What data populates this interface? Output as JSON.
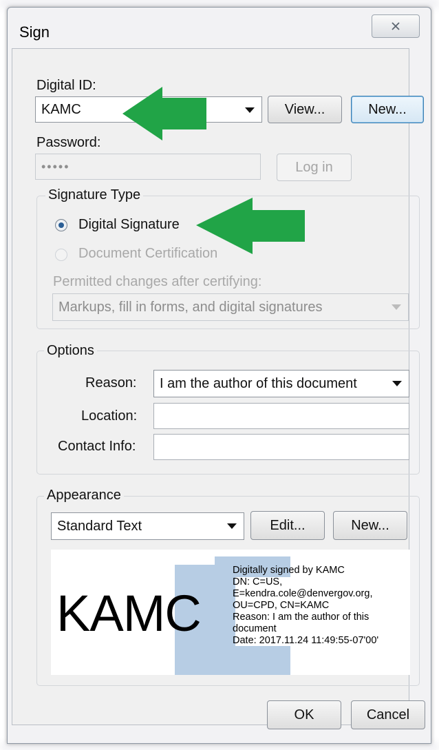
{
  "window": {
    "title": "Sign"
  },
  "digital_id": {
    "label": "Digital ID:",
    "selected": "KAMC",
    "view_label": "View...",
    "new_label": "New..."
  },
  "password": {
    "label": "Password:",
    "value": "•••••",
    "login_label": "Log in"
  },
  "signature_type": {
    "title": "Signature Type",
    "digital_signature": "Digital Signature",
    "document_certification": "Document Certification",
    "permitted_label": "Permitted changes after certifying:",
    "permitted_selected": "Markups, fill in forms, and digital signatures"
  },
  "options": {
    "title": "Options",
    "reason_label": "Reason:",
    "reason_value": "I am the author of this document",
    "location_label": "Location:",
    "location_value": "",
    "contact_label": "Contact Info:",
    "contact_value": ""
  },
  "appearance": {
    "title": "Appearance",
    "selected": "Standard Text",
    "edit_label": "Edit...",
    "new_label": "New..."
  },
  "preview": {
    "name": "KAMC",
    "lines": [
      "Digitally signed by KAMC",
      "DN: C=US,",
      "E=kendra.cole@denvergov.org,",
      "OU=CPD, CN=KAMC",
      "Reason: I am the author of this",
      "document",
      "Date: 2017.11.24 11:49:55-07'00'"
    ]
  },
  "footer": {
    "ok_label": "OK",
    "cancel_label": "Cancel"
  },
  "colors": {
    "arrow": "#21a447",
    "logo": "#b7cde4",
    "radio_dot": "#2b5f96"
  }
}
